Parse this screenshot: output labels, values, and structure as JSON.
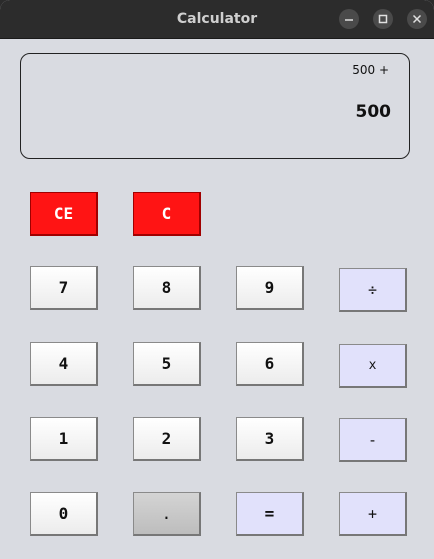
{
  "window": {
    "title": "Calculator"
  },
  "display": {
    "expression": "500 +",
    "result": "500"
  },
  "keys": {
    "ce": "CE",
    "c": "C",
    "k7": "7",
    "k8": "8",
    "k9": "9",
    "div": "÷",
    "k4": "4",
    "k5": "5",
    "k6": "6",
    "mul": "x",
    "k1": "1",
    "k2": "2",
    "k3": "3",
    "sub": "-",
    "k0": "0",
    "dot": ".",
    "eq": "=",
    "add": "+"
  },
  "colors": {
    "clear_keys": "#ff1414",
    "operator_keys": "#e1e1fb",
    "background": "#d9dbe1",
    "titlebar": "#2c2c2c"
  },
  "icons": [
    "minimize-icon",
    "maximize-icon",
    "close-icon"
  ]
}
